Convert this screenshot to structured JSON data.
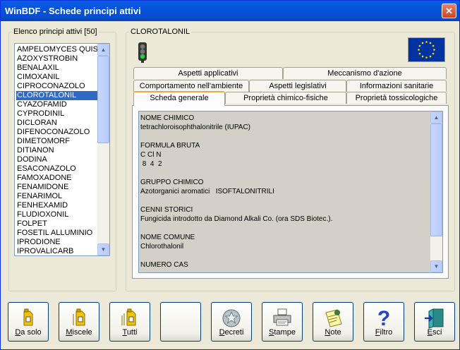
{
  "window": {
    "title": "WinBDF - Schede principi attivi",
    "close_glyph": "✕"
  },
  "list_panel": {
    "legend": "Elenco principi attivi [50]",
    "items": [
      "AMPELOMYCES QUISQ",
      "AZOXYSTROBIN",
      "BENALAXIL",
      "CIMOXANIL",
      "CIPROCONAZOLO",
      "CLOROTALONIL",
      "CYAZOFAMID",
      "CYPRODINIL",
      "DICLORAN",
      "DIFENOCONAZOLO",
      "DIMETOMORF",
      "DITIANON",
      "DODINA",
      "ESACONAZOLO",
      "FAMOXADONE",
      "FENAMIDONE",
      "FENARIMOL",
      "FENHEXAMID",
      "FLUDIOXONIL",
      "FOLPET",
      "FOSETIL ALLUMINIO",
      "IPRODIONE",
      "IPROVALICARB"
    ],
    "selected_index": 5
  },
  "detail": {
    "legend": "CLOROTALONIL",
    "traffic_light_icon": "traffic-light-icon",
    "flag_icon": "eu-flag-icon",
    "tabs_row1": [
      "Aspetti applicativi",
      "Meccanismo d'azione"
    ],
    "tabs_row2": [
      "Comportamento nell'ambiente",
      "Aspetti legislativi",
      "Informazioni sanitarie"
    ],
    "tabs_row3": [
      "Scheda generale",
      "Proprietà chimico-fisiche",
      "Proprietà tossicologiche"
    ],
    "active_tab": "Scheda generale",
    "content": "NOME CHIMICO\ntetrachloroisophthalonitrile (IUPAC)\n\nFORMULA BRUTA\nC Cl N\n 8  4  2\n\nGRUPPO CHIMICO\nAzotorganici aromatici   ISOFTALONITRILI\n\nCENNI STORICI\nFungicida introdotto da Diamond Alkali Co. (ora SDS Biotec.).\n\nNOME COMUNE\nChlorothalonil\n\nNUMERO CAS"
  },
  "toolbar": {
    "buttons": [
      {
        "label": "Da solo",
        "accel": "D",
        "rest": "a solo",
        "icon": "jerrycan-icon"
      },
      {
        "label": "Miscele",
        "accel": "M",
        "rest": "iscele",
        "icon": "jerrycans-icon"
      },
      {
        "label": "Tutti",
        "accel": "T",
        "rest": "utti",
        "icon": "jerrycans-many-icon"
      },
      {
        "label": "",
        "accel": "",
        "rest": "",
        "icon": "blank"
      },
      {
        "label": "Decreti",
        "accel": "D",
        "rest": "ecreti",
        "icon": "emblem-icon"
      },
      {
        "label": "Stampe",
        "accel": "S",
        "rest": "tampe",
        "icon": "printer-icon"
      },
      {
        "label": "Note",
        "accel": "N",
        "rest": "ote",
        "icon": "note-icon"
      },
      {
        "label": "Filtro",
        "accel": "F",
        "rest": "iltro",
        "icon": "question-icon"
      },
      {
        "label": "Esci",
        "accel": "E",
        "rest": "sci",
        "icon": "exit-door-icon"
      }
    ]
  }
}
